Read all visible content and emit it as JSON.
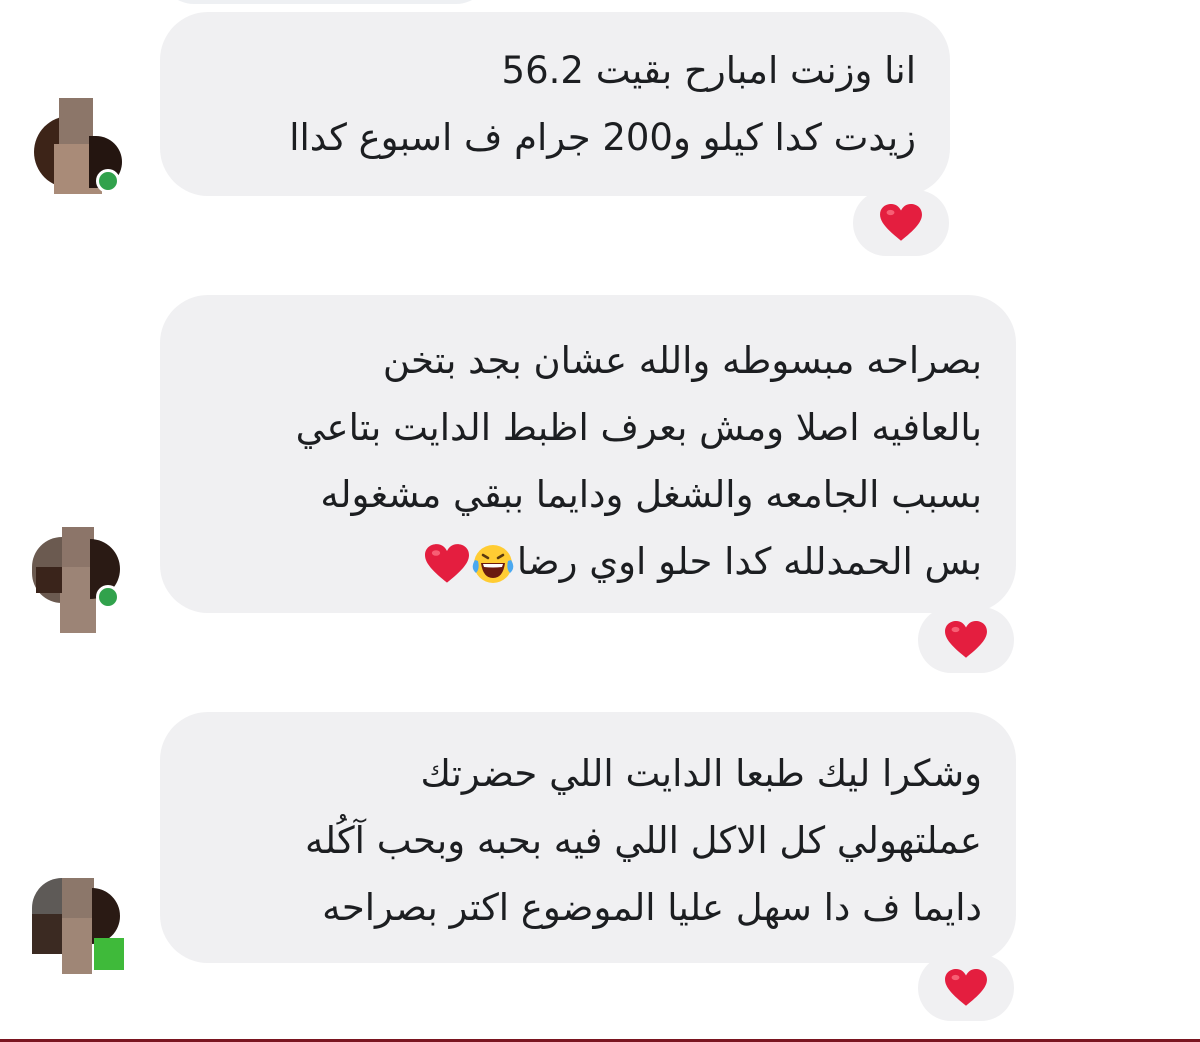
{
  "messages": [
    {
      "lines": [
        "انا وزنت امبارح بقيت 56.2",
        "زيدت كدا كيلو و200 جرام ف اسبوع كداا"
      ],
      "reaction": "heart-icon",
      "sender_online": true
    },
    {
      "lines": [
        "بصراحه مبسوطه والله عشان بجد بتخن",
        "بالعافيه اصلا ومش بعرف اظبط الدايت بتاعي",
        "بسبب الجامعه والشغل ودايما ببقي مشغوله",
        "بس الحمدلله كدا حلو اوي رضا"
      ],
      "trailing_icons": [
        "laughing-tears-emoji",
        "heart-icon"
      ],
      "reaction": "heart-icon",
      "sender_online": true
    },
    {
      "lines": [
        "وشكرا ليك طبعا الدايت اللي حضرتك",
        "عملتهولي كل الاكل اللي فيه بحبه وبحب آكُله",
        "دايما ف دا سهل عليا الموضوع اكتر بصراحه"
      ],
      "reaction": "heart-icon",
      "sender_online": true
    }
  ],
  "colors": {
    "bubble": "#f0f0f2",
    "text": "#1c1e21",
    "heart": "#e41e3f",
    "online": "#31a24c",
    "bottom_bar": "#7a1520"
  }
}
